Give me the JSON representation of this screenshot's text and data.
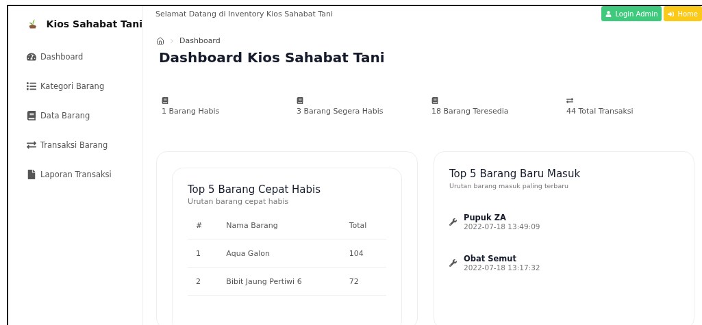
{
  "brand": {
    "name": "Kios Sahabat Tani"
  },
  "header": {
    "welcome": "Selamat Datang di Inventory Kios Sahabat Tani",
    "buttons": [
      {
        "kind": "login",
        "label": "Login Admin"
      },
      {
        "kind": "home",
        "label": "Home"
      }
    ]
  },
  "sidebar": {
    "items": [
      {
        "kind": "gauge",
        "label": "Dashboard"
      },
      {
        "kind": "list",
        "label": "Kategori Barang"
      },
      {
        "kind": "book",
        "label": "Data Barang"
      },
      {
        "kind": "transfer",
        "label": "Transaksi Barang"
      },
      {
        "kind": "file",
        "label": "Laporan Transaksi"
      }
    ]
  },
  "breadcrumb": [
    "Dashboard"
  ],
  "page_title": "Dashboard Kios Sahabat Tani",
  "stats": [
    {
      "kind": "book",
      "label": "1 Barang Habis"
    },
    {
      "kind": "book",
      "label": "3 Barang Segera Habis"
    },
    {
      "kind": "book",
      "label": "18 Barang Teresedia"
    },
    {
      "kind": "transfer",
      "label": "44 Total Transaksi"
    }
  ],
  "top_fast": {
    "title": "Top 5 Barang Cepat Habis",
    "subtitle": "Urutan barang cepat habis",
    "columns": [
      "#",
      "Nama Barang",
      "Total"
    ],
    "rows": [
      [
        "1",
        "Aqua Galon",
        "104"
      ],
      [
        "2",
        "Bibit Jaung Pertiwi 6",
        "72"
      ]
    ]
  },
  "top_new": {
    "title": "Top 5 Barang Baru Masuk",
    "subtitle": "Urutan barang masuk paling terbaru",
    "items": [
      {
        "name": "Pupuk ZA",
        "time": "2022-07-18 13:49:09"
      },
      {
        "name": "Obat Semut",
        "time": "2022-07-18 13:17:32"
      }
    ]
  }
}
